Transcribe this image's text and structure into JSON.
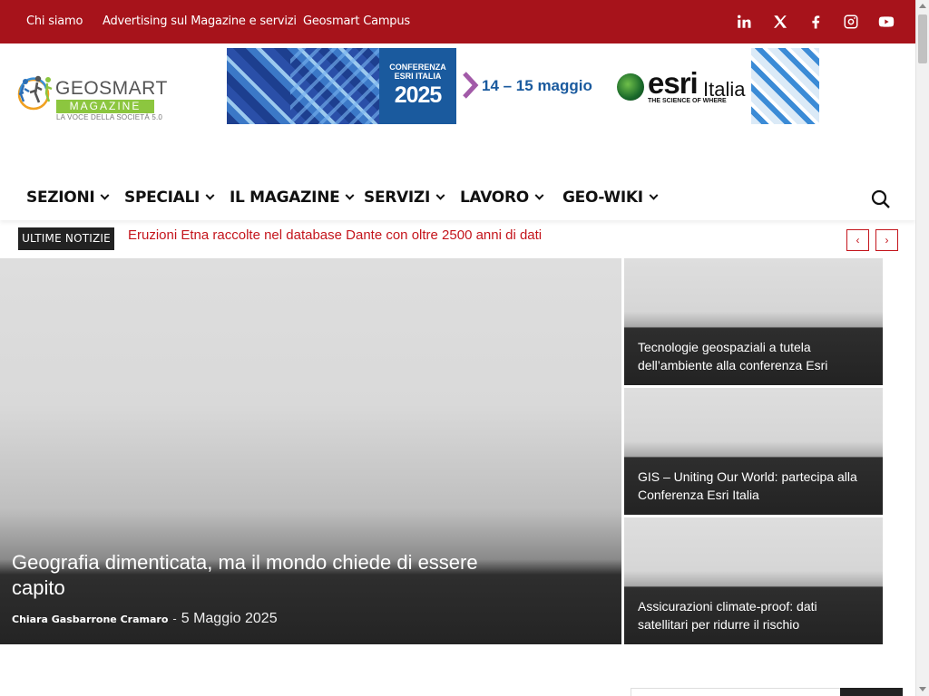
{
  "topbar": {
    "links": [
      "Chi siamo",
      "Advertising sul Magazine e servizi",
      "Geosmart Campus"
    ],
    "social": [
      "linkedin-icon",
      "x-twitter-icon",
      "facebook-icon",
      "instagram-icon",
      "youtube-icon"
    ],
    "background": "#a7131b"
  },
  "logo": {
    "line1": "GEOSMART",
    "line2": "MAGAZINE",
    "tagline": "LA VOCE DELLA SOCIETÀ 5.0",
    "accent": "#8cc63f"
  },
  "banner": {
    "conference_line": "CONFERENZA ESRI ITALIA",
    "year": "2025",
    "dates": "14 – 15 maggio",
    "brand": "esri",
    "brand_suffix": "Italia",
    "slogan": "THE SCIENCE OF WHERE"
  },
  "nav": {
    "items": [
      "SEZIONI",
      "SPECIALI",
      "IL MAGAZINE",
      "SERVIZI",
      "LAVORO",
      "GEO-WIKI"
    ]
  },
  "ticker": {
    "label": "ULTIME NOTIZIE",
    "headline": "Eruzioni Etna raccolte nel database Dante con oltre 2500 anni di dati",
    "prev": "‹",
    "next": "›",
    "accent": "#c4151c"
  },
  "featured": {
    "title": "Geografia dimenticata, ma il mondo chiede di essere capito",
    "author": "Chiara Gasbarrone Cramaro",
    "separator": "-",
    "date": "5 Maggio 2025"
  },
  "side_articles": [
    {
      "title": "Tecnologie geospaziali a tutela dell’ambiente alla conferenza Esri"
    },
    {
      "title": "GIS – Uniting Our World: partecipa alla Conferenza Esri Italia"
    },
    {
      "title": "Assicurazioni climate-proof: dati satellitari per ridurre il rischio"
    }
  ]
}
